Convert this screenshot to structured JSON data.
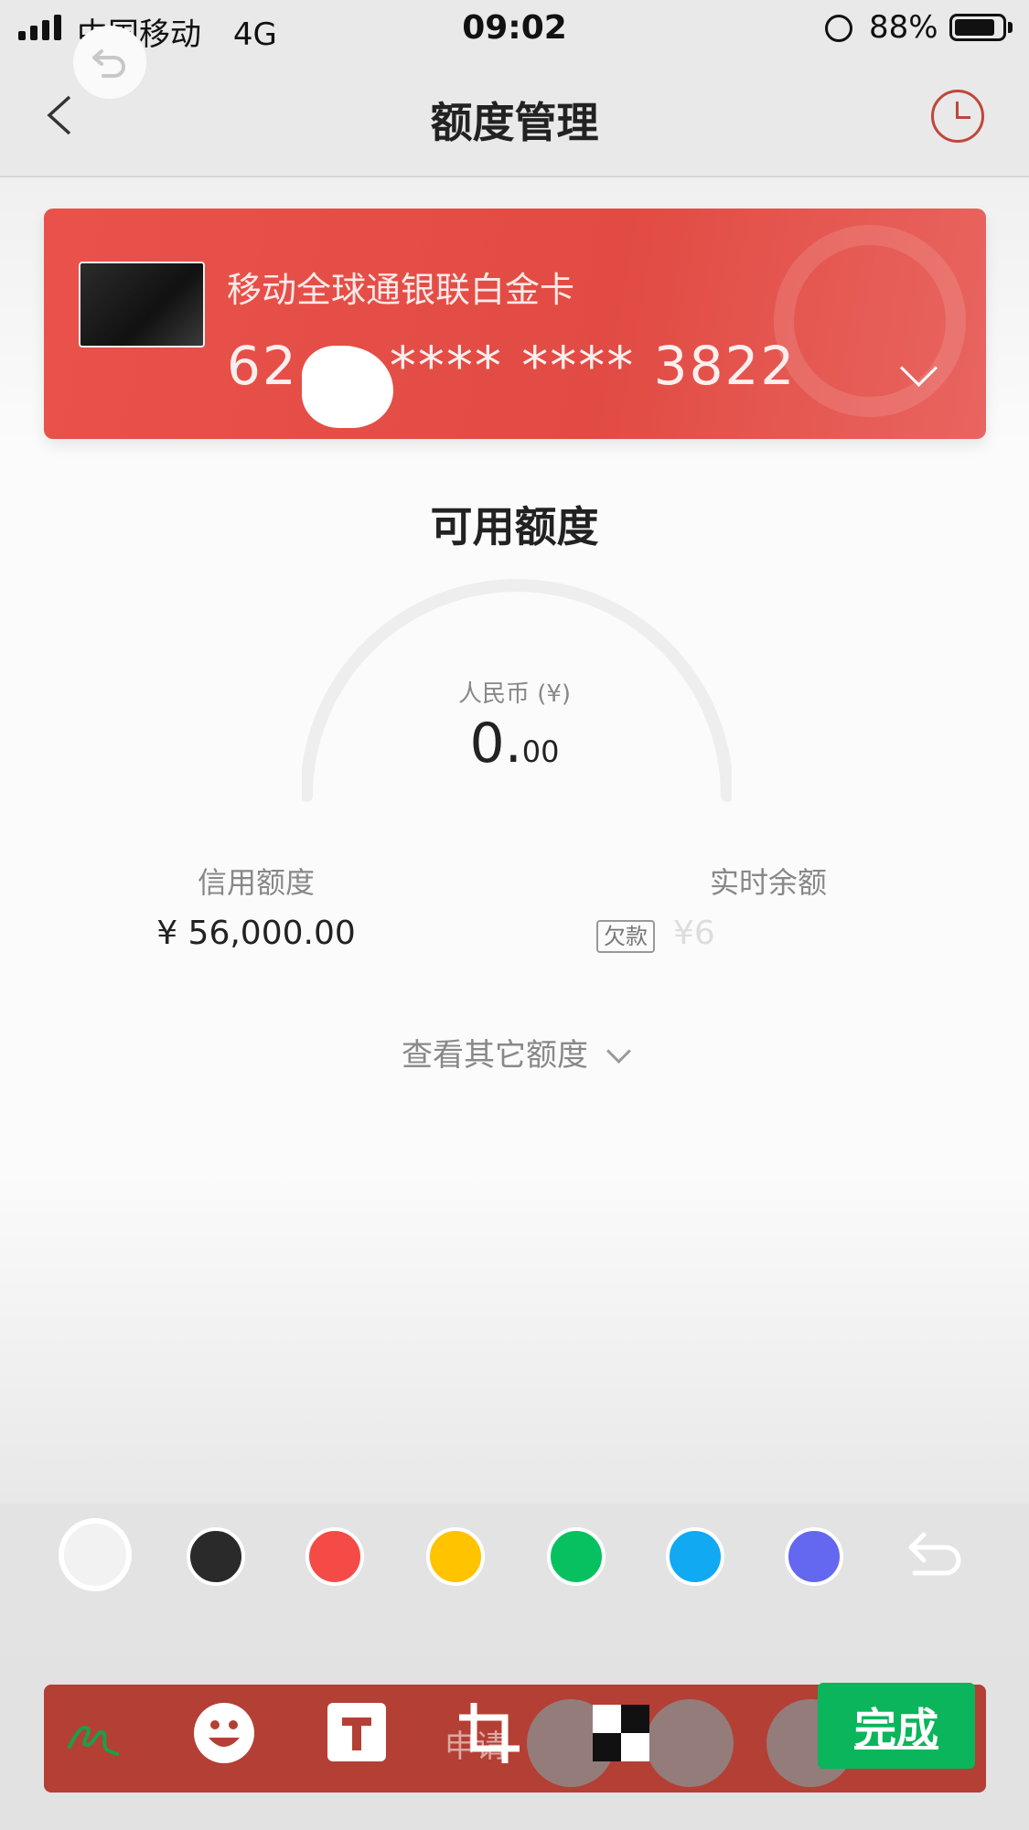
{
  "status_bar": {
    "carrier": "中国移动",
    "network": "4G",
    "time": "09:02",
    "battery": "88%"
  },
  "nav": {
    "title": "额度管理"
  },
  "card": {
    "name": "移动全球通银联白金卡",
    "number_prefix": "62",
    "number_masked": "**** **** 3822"
  },
  "limits": {
    "available_title": "可用额度",
    "currency_label": "人民币 (¥)",
    "available_int": "0.",
    "available_dec": "00",
    "credit_label": "信用额度",
    "credit_value": "¥ 56,000.00",
    "balance_label": "实时余额",
    "debt_badge": "欠款",
    "balance_value": "¥6",
    "view_others": "查看其它额度"
  },
  "palette": {
    "colors": [
      "#f2f2f2",
      "#2a2a2a",
      "#f44b47",
      "#ffc300",
      "#07c160",
      "#12a9f3",
      "#6467ef"
    ]
  },
  "toolbar": {
    "apply_label": "申请",
    "done_label": "完成"
  },
  "icons": [
    "signal-icon",
    "rotation-lock-icon",
    "battery-icon",
    "undo-icon",
    "back-icon",
    "history-clock-icon",
    "chevron-down-icon",
    "doodle-pen-icon",
    "emoji-icon",
    "text-icon",
    "crop-icon",
    "mosaic-icon"
  ]
}
